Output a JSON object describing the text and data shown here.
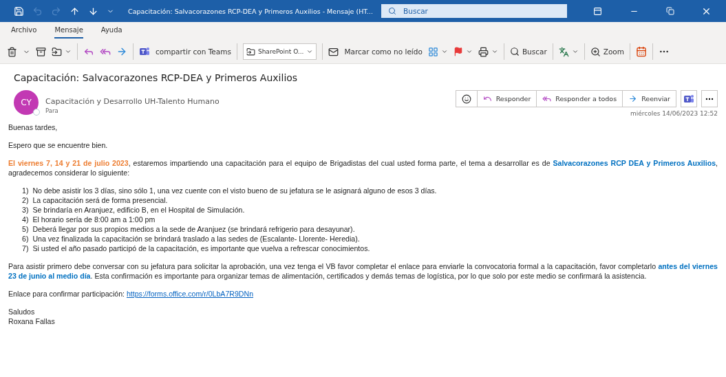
{
  "window": {
    "title": "Capacitación: Salvacorazones RCP-DEA y Primeros Auxilios  -  Mensaje (HT...",
    "search_placeholder": "Buscar"
  },
  "quick_access": [
    {
      "disabled": false
    },
    {
      "disabled": true
    },
    {
      "disabled": true
    },
    {
      "disabled": false
    },
    {
      "disabled": false
    },
    {
      "disabled": false
    }
  ],
  "tabs": [
    {
      "label": "Archivo",
      "selected": false
    },
    {
      "label": "Mensaje",
      "selected": true
    },
    {
      "label": "Ayuda",
      "selected": false
    }
  ],
  "toolbar": {
    "teams": "compartir con Teams",
    "sharepoint": "SharePoint O...",
    "mark_unread": "Marcar como no leído",
    "search": "Buscar",
    "zoom": "Zoom"
  },
  "message": {
    "subject": "Capacitación: Salvacorazones RCP-DEA y Primeros Auxilios",
    "avatar": "CY",
    "sender": "Capacitación y Desarrollo UH-Talento Humano",
    "to_label": "Para",
    "date": "miércoles 14/06/2023 12:52",
    "actions": [
      "Responder",
      "Responder a todos",
      "Reenviar"
    ]
  },
  "body": {
    "greeting": "Buenas tardes,",
    "intro": "Espero que se encuentre bien.",
    "paragraph_1": [
      {
        "kind": "date",
        "text": "El viernes 7, 14 y 21 de julio 2023"
      },
      {
        "kind": "plain",
        "text": ", estaremos impartiendo una capacitación para el equipo de Brigadistas del cual usted forma parte, el tema a desarrollar es de "
      },
      {
        "kind": "topic",
        "text": "Salvacorazones RCP DEA y Primeros Auxilios"
      },
      {
        "kind": "plain",
        "text": ", agradecemos considerar lo siguiente:"
      }
    ],
    "list": [
      {
        "number": "1)",
        "text": "No debe asistir los 3 días, sino sólo 1, una vez cuente con el visto bueno de su jefatura se le asignará alguno de esos 3 días."
      },
      {
        "number": "2)",
        "text": "La capacitación será de forma presencial."
      },
      {
        "number": "3)",
        "text": "Se brindaría en Aranjuez, edificio B, en el Hospital de Simulación."
      },
      {
        "number": "4)",
        "text": "El horario sería de 8:00 am a 1:00 pm"
      },
      {
        "number": "5)",
        "text": "Deberá llegar por sus propios medios a la sede de Aranjuez (se brindará refrigerio para desayunar)."
      },
      {
        "number": "6)",
        "text": "Una vez finalizada la capacitación se brindará traslado a las sedes de (Escalante- Llorente- Heredia)."
      },
      {
        "number": "7)",
        "text": "Si usted el año pasado participó de la capacitación, es importante que vuelva a refrescar conocimientos."
      }
    ],
    "paragraph_2": [
      {
        "kind": "plain",
        "text": "Para asistir primero debe conversar con su jefatura para solicitar la aprobación, una vez tenga el VB favor completar el enlace para enviarle la convocatoria formal a la capacitación, favor completarlo "
      },
      {
        "kind": "topic",
        "text": "antes del viernes 23 de junio al medio día"
      },
      {
        "kind": "plain",
        "text": ". Esta confirmación es importante para organizar temas de alimentación, certificados y demás temas de logística, por lo que solo por este medio se confirmará la asistencia."
      }
    ],
    "link_label": "Enlace para confirmar participación:",
    "link": "https://forms.office.com/r/0LbA7R9DNn",
    "closing": "Saludos",
    "signature": "Roxana Fallas"
  }
}
